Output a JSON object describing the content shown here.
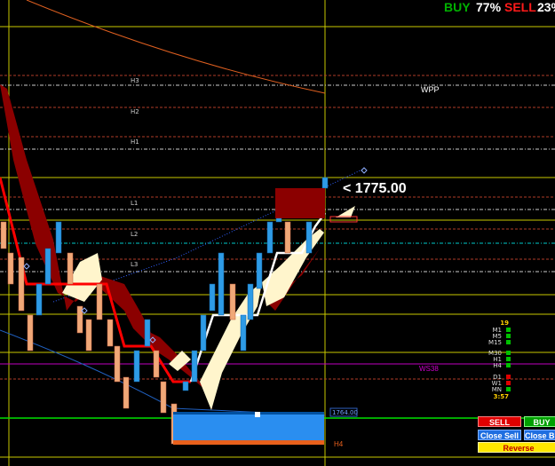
{
  "hud": {
    "buy_label": "BUY",
    "buy_pct": "77%",
    "sell_label": "SELL",
    "sell_pct": "23%"
  },
  "levels": {
    "h3": "H3",
    "h2": "H2",
    "h1": "H1",
    "l1": "L1",
    "l2": "L2",
    "l3": "L3",
    "h4": "H4",
    "wpp": "WPP",
    "ws38": "WS38"
  },
  "price": {
    "current": "<  1775.00",
    "tag": "1764.00"
  },
  "timeframes": {
    "top_count": "19",
    "items": [
      "M1",
      "M5",
      "M15",
      "M30",
      "H1",
      "H4",
      "D1",
      "W1",
      "MN"
    ],
    "timer": "3:57"
  },
  "buttons": {
    "sell": "SELL",
    "buy": "BUY",
    "close_sell": "Close Sell",
    "close_buy": "Close Buy",
    "reverse": "Reverse"
  },
  "colors": {
    "bull": "#2e9be6",
    "bear": "#f0a878",
    "trend_line": "#ff0000",
    "cloud_dark": "#8b0000",
    "cloud_light": "#fff5cc",
    "hud_buy": "#00b000",
    "hud_sell": "#ff1a1a"
  }
}
